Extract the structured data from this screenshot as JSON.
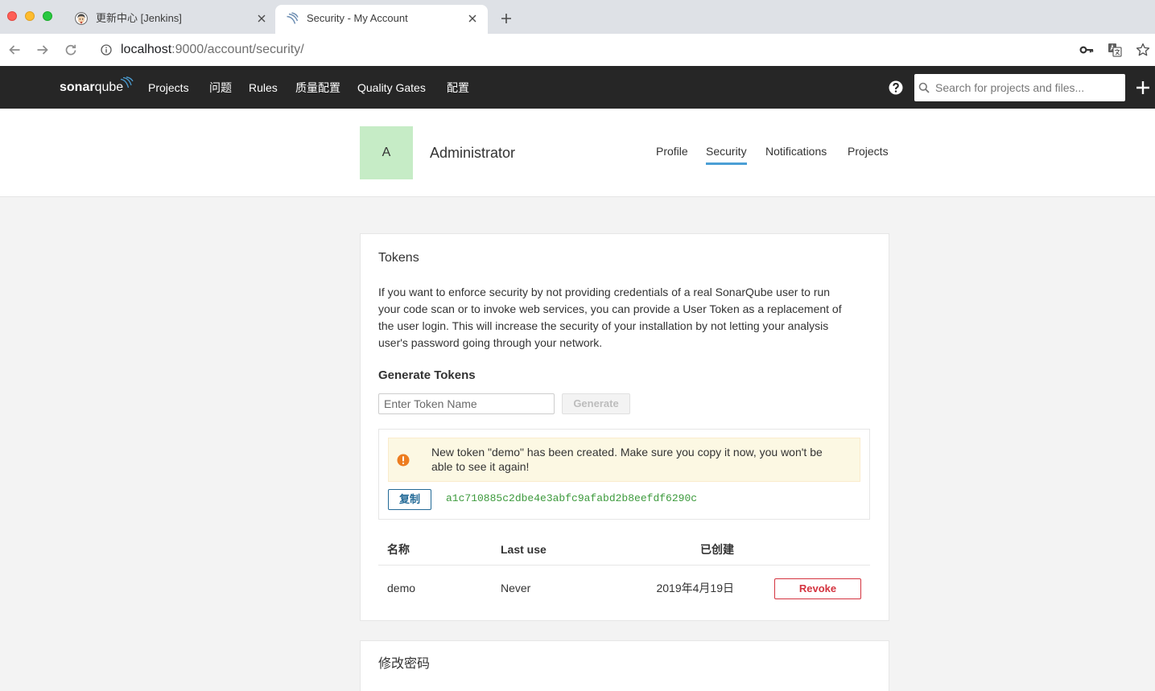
{
  "browser": {
    "tabs": [
      {
        "title": "更新中心 [Jenkins]",
        "icon": "jenkins-icon",
        "active": false
      },
      {
        "title": "Security - My Account",
        "icon": "sonarqube-icon",
        "active": true
      }
    ],
    "url": {
      "host": "localhost",
      "rest": ":9000/account/security/"
    },
    "toolbar_icons": [
      "back-arrow-icon",
      "forward-arrow-icon",
      "reload-icon",
      "site-info-icon",
      "key-icon",
      "translate-icon",
      "bookmark-star-icon"
    ]
  },
  "navbar": {
    "logo": {
      "bold": "sonar",
      "light": "qube"
    },
    "items": [
      "Projects",
      "问题",
      "Rules",
      "质量配置",
      "Quality Gates",
      "配置"
    ],
    "search_placeholder": "Search for projects and files...",
    "icons": [
      "help-icon",
      "search-icon",
      "plus-icon"
    ]
  },
  "account": {
    "avatar_letter": "A",
    "name": "Administrator",
    "tabs": [
      "Profile",
      "Security",
      "Notifications",
      "Projects"
    ],
    "active_tab": "Security"
  },
  "tokens": {
    "title": "Tokens",
    "description": [
      "If you want to enforce security by not providing credentials of a real SonarQube user to run",
      "your code scan or to invoke web services, you can provide a User Token as a replacement of",
      "the user login. This will increase the security of your installation by not letting your analysis",
      "user's password going through your network."
    ],
    "generate_title": "Generate Tokens",
    "input_placeholder": "Enter Token Name",
    "generate_label": "Generate",
    "alert_icon": "warning-icon",
    "alert_lines": [
      "New token \"demo\" has been created. Make sure you copy it now, you won't be",
      "able to see it again!"
    ],
    "copy_label": "复制",
    "token_value": "a1c710885c2dbe4e3abfc9afabd2b8eefdf6290c",
    "table": {
      "headers": [
        "名称",
        "Last use",
        "已创建"
      ],
      "rows": [
        {
          "name": "demo",
          "last_use": "Never",
          "created": "2019年4月19日",
          "action": "Revoke"
        }
      ]
    }
  },
  "password": {
    "title": "修改密码"
  },
  "colors": {
    "navbar_bg": "#262626",
    "page_bg": "#f3f3f3",
    "accent": "#4b9fd5",
    "avatar_bg": "#c6ecc6",
    "link": "#236a97",
    "danger": "#d4333f",
    "token": "#3c9a3c",
    "warning": "#ed7d20",
    "alert_bg": "#fcf8e3"
  }
}
